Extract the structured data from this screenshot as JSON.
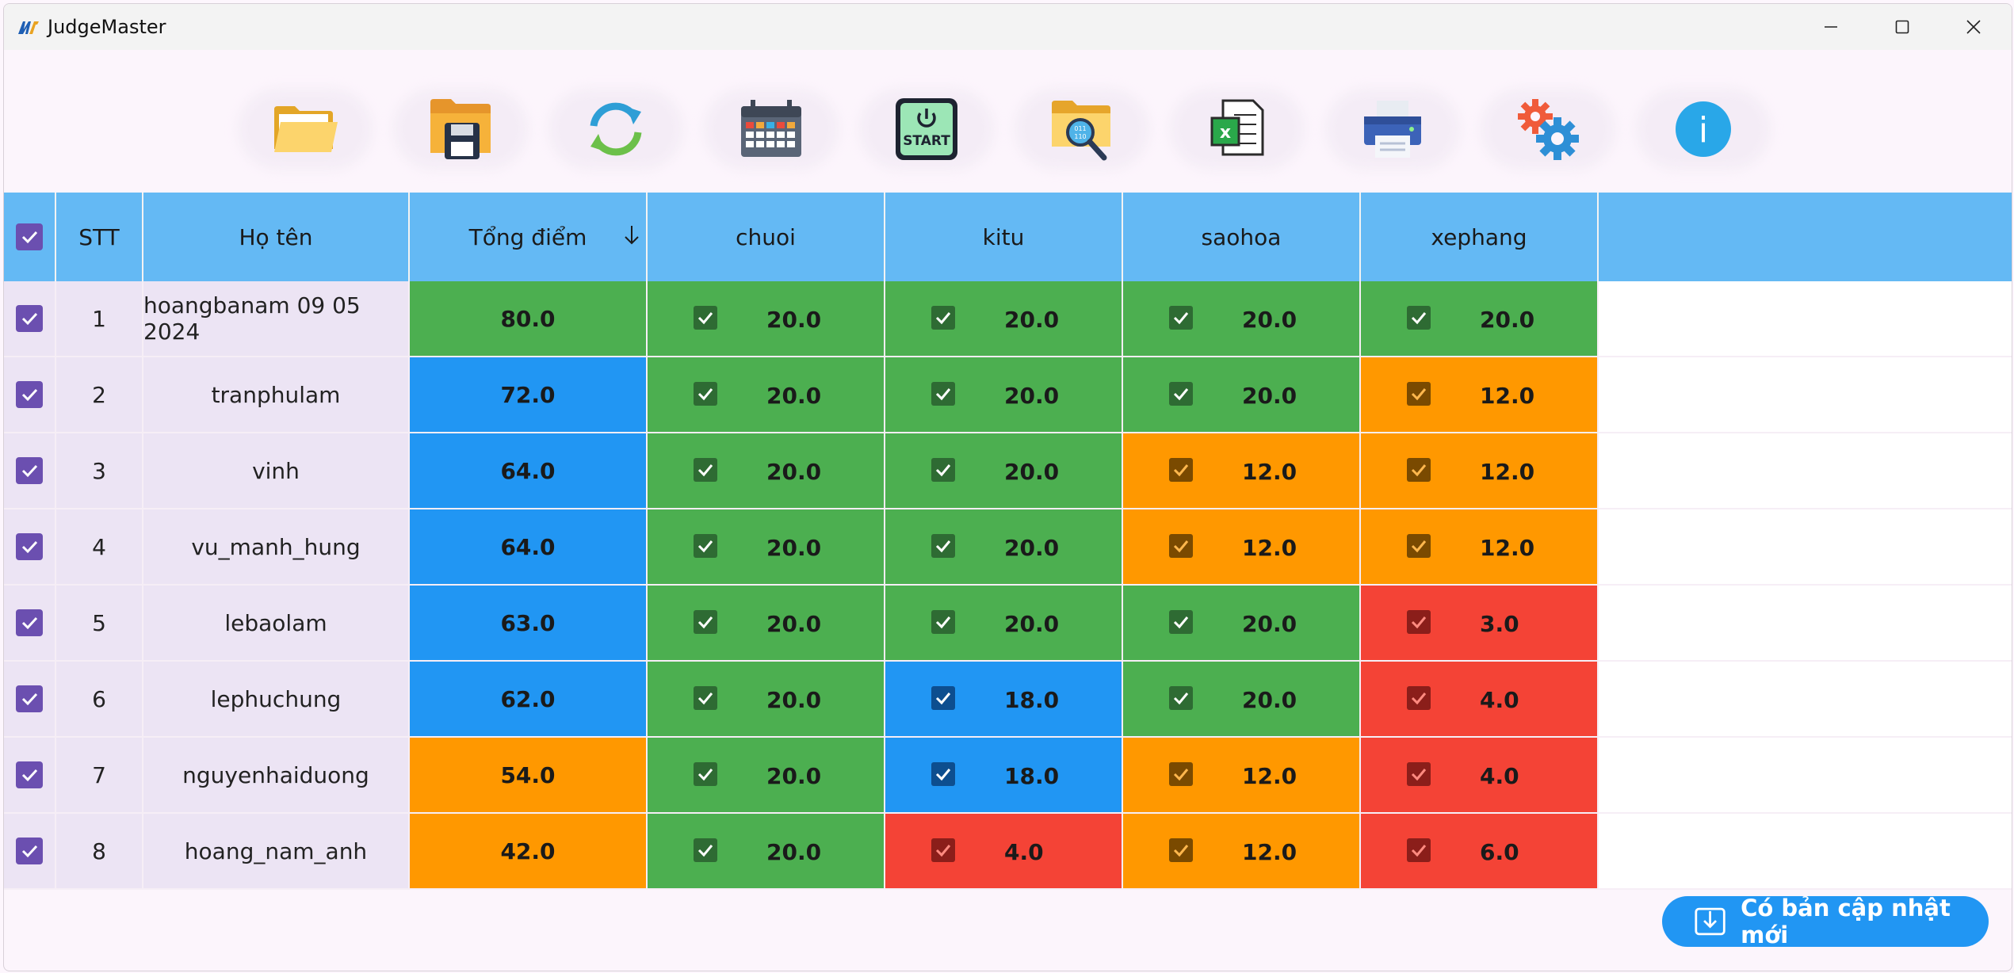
{
  "app": {
    "title": "JudgeMaster"
  },
  "toolbar": {
    "buttons": [
      {
        "name": "open-folder-button",
        "icon": "folder-open-icon"
      },
      {
        "name": "save-button",
        "icon": "save-folder-icon"
      },
      {
        "name": "refresh-button",
        "icon": "refresh-icon"
      },
      {
        "name": "schedule-button",
        "icon": "calendar-icon"
      },
      {
        "name": "start-button",
        "icon": "start-power-icon",
        "label": "START"
      },
      {
        "name": "search-folder-button",
        "icon": "folder-search-icon"
      },
      {
        "name": "export-excel-button",
        "icon": "excel-icon"
      },
      {
        "name": "print-button",
        "icon": "printer-icon"
      },
      {
        "name": "settings-button",
        "icon": "gears-icon"
      },
      {
        "name": "info-button",
        "icon": "info-icon",
        "label": "i"
      }
    ]
  },
  "table": {
    "headers": {
      "stt": "STT",
      "name": "Họ tên",
      "total": "Tổng điểm",
      "problems": [
        "chuoi",
        "kitu",
        "saohoa",
        "xephang"
      ]
    },
    "sort_icon": "arrow-down-icon",
    "colors": {
      "green": "#4caf50",
      "blue": "#2196f3",
      "orange": "#ff9800",
      "red": "#f44336",
      "header": "#64b9f4",
      "checkbox": "#6b4fb0"
    },
    "rows": [
      {
        "stt": "1",
        "name": "hoangbanam 09 05 2024",
        "total": "80.0",
        "total_color": "green",
        "scores": [
          {
            "v": "20.0",
            "c": "green"
          },
          {
            "v": "20.0",
            "c": "green"
          },
          {
            "v": "20.0",
            "c": "green"
          },
          {
            "v": "20.0",
            "c": "green"
          }
        ]
      },
      {
        "stt": "2",
        "name": "tranphulam",
        "total": "72.0",
        "total_color": "blue",
        "scores": [
          {
            "v": "20.0",
            "c": "green"
          },
          {
            "v": "20.0",
            "c": "green"
          },
          {
            "v": "20.0",
            "c": "green"
          },
          {
            "v": "12.0",
            "c": "orange"
          }
        ]
      },
      {
        "stt": "3",
        "name": "vinh",
        "total": "64.0",
        "total_color": "blue",
        "scores": [
          {
            "v": "20.0",
            "c": "green"
          },
          {
            "v": "20.0",
            "c": "green"
          },
          {
            "v": "12.0",
            "c": "orange"
          },
          {
            "v": "12.0",
            "c": "orange"
          }
        ]
      },
      {
        "stt": "4",
        "name": "vu_manh_hung",
        "total": "64.0",
        "total_color": "blue",
        "scores": [
          {
            "v": "20.0",
            "c": "green"
          },
          {
            "v": "20.0",
            "c": "green"
          },
          {
            "v": "12.0",
            "c": "orange"
          },
          {
            "v": "12.0",
            "c": "orange"
          }
        ]
      },
      {
        "stt": "5",
        "name": "lebaolam",
        "total": "63.0",
        "total_color": "blue",
        "scores": [
          {
            "v": "20.0",
            "c": "green"
          },
          {
            "v": "20.0",
            "c": "green"
          },
          {
            "v": "20.0",
            "c": "green"
          },
          {
            "v": "3.0",
            "c": "red"
          }
        ]
      },
      {
        "stt": "6",
        "name": "lephuchung",
        "total": "62.0",
        "total_color": "blue",
        "scores": [
          {
            "v": "20.0",
            "c": "green"
          },
          {
            "v": "18.0",
            "c": "blue"
          },
          {
            "v": "20.0",
            "c": "green"
          },
          {
            "v": "4.0",
            "c": "red"
          }
        ]
      },
      {
        "stt": "7",
        "name": "nguyenhaiduong",
        "total": "54.0",
        "total_color": "orange",
        "scores": [
          {
            "v": "20.0",
            "c": "green"
          },
          {
            "v": "18.0",
            "c": "blue"
          },
          {
            "v": "12.0",
            "c": "orange"
          },
          {
            "v": "4.0",
            "c": "red"
          }
        ]
      },
      {
        "stt": "8",
        "name": "hoang_nam_anh",
        "total": "42.0",
        "total_color": "orange",
        "scores": [
          {
            "v": "20.0",
            "c": "green"
          },
          {
            "v": "4.0",
            "c": "red"
          },
          {
            "v": "12.0",
            "c": "orange"
          },
          {
            "v": "6.0",
            "c": "red"
          }
        ]
      }
    ]
  },
  "update_button": {
    "label": "Có bản cập nhật mới",
    "icon": "download-icon"
  }
}
